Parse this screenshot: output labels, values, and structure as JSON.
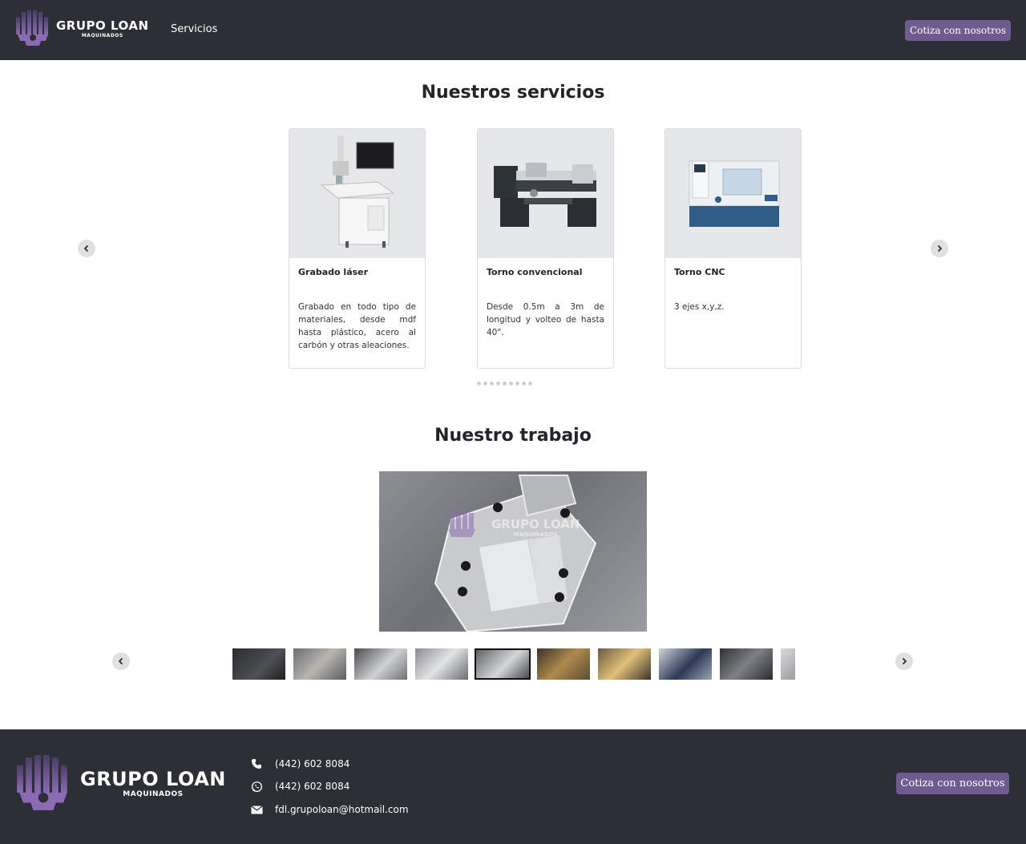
{
  "header": {
    "logo_main": "GRUPO LOAN",
    "logo_sub": "MAQUINADOS",
    "nav_servicios": "Servicios",
    "cta_label": "Cotiza con nosotros"
  },
  "services": {
    "title": "Nuestros servicios",
    "cards": [
      {
        "title": "Grabado láser",
        "text": "Grabado en todo tipo de materiales, desde mdf hasta plástico, acero al carbón y otras aleaciones."
      },
      {
        "title": "Torno convencional",
        "text": "Desde 0.5m a 3m de longitud y volteo de hasta 40\"."
      },
      {
        "title": "Torno CNC",
        "text": "3 ejes x,y,z."
      }
    ],
    "dot_count": 9
  },
  "work": {
    "title": "Nuestro trabajo",
    "watermark_main": "GRUPO LOAN",
    "watermark_sub": "MAQUINADOS",
    "thumbnail_count": 10,
    "active_thumbnail": 5
  },
  "footer": {
    "logo_main": "GRUPO LOAN",
    "logo_sub": "MAQUINADOS",
    "phone": "(442) 602 8084",
    "whatsapp": "(442) 602 8084",
    "email": "fdl.grupoloan@hotmail.com",
    "cta_label": "Cotiza con nosotros"
  },
  "colors": {
    "header_bg": "#2c2f35",
    "accent": "#6f5b8f"
  }
}
